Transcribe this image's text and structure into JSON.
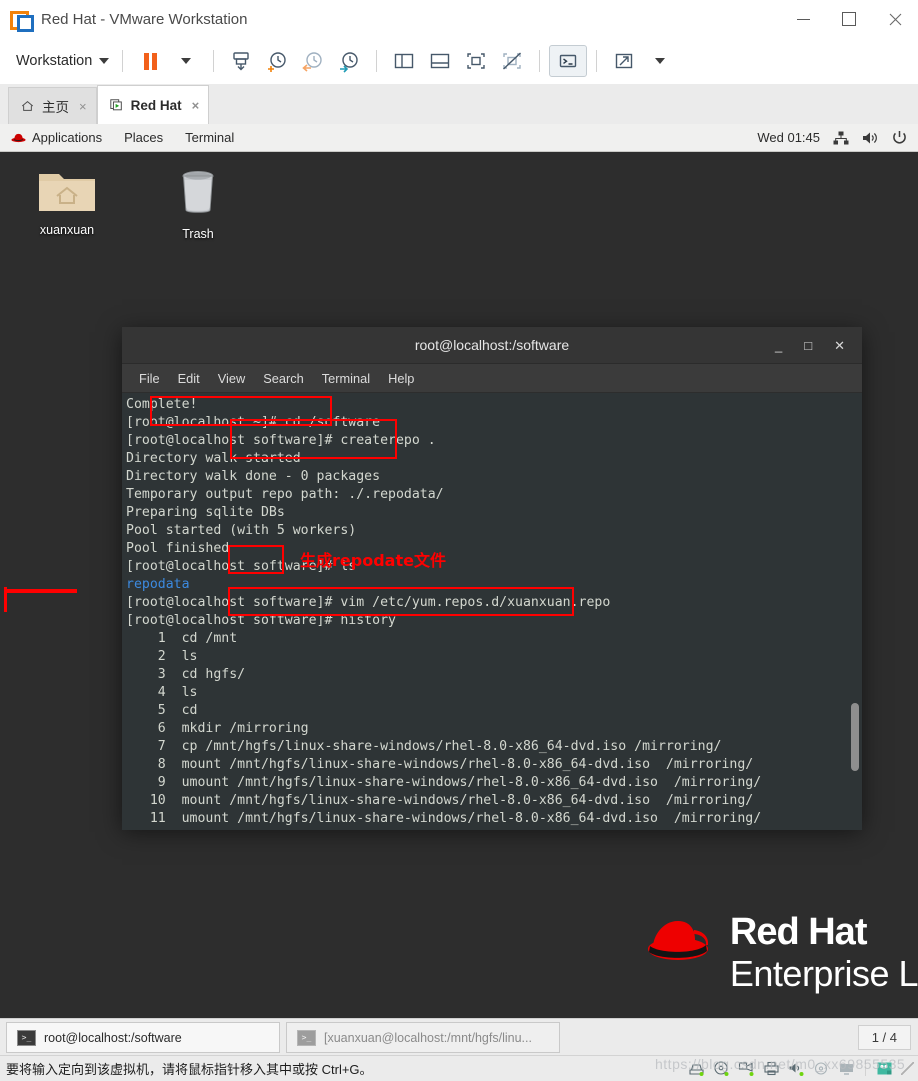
{
  "window": {
    "title": "Red Hat - VMware Workstation",
    "logo_icon": "vmware-logo-icon",
    "minimize_label": "Minimize",
    "maximize_label": "Maximize",
    "close_label": "Close"
  },
  "toolbar": {
    "workstation_menu": "Workstation",
    "items": [
      {
        "name": "pause-button",
        "icon": "pause-icon"
      },
      {
        "name": "pause-dropdown",
        "icon": "chevron-down-icon"
      },
      {
        "name": "send-ctrl-alt-del-button",
        "icon": "snapshot-save-icon"
      },
      {
        "name": "take-snapshot-button",
        "icon": "clock-plus-icon"
      },
      {
        "name": "revert-snapshot-button",
        "icon": "clock-back-icon"
      },
      {
        "name": "snapshot-manager-button",
        "icon": "clock-wrench-icon"
      },
      {
        "name": "show-side-panel-button",
        "icon": "panel-left-icon"
      },
      {
        "name": "show-bottom-panel-button",
        "icon": "panel-bottom-icon"
      },
      {
        "name": "console-view-button",
        "icon": "fit-guest-icon"
      },
      {
        "name": "no-console-view-button",
        "icon": "fit-guest-disabled-icon"
      },
      {
        "name": "terminal-view-button",
        "icon": "terminal-prompt-icon"
      },
      {
        "name": "fullscreen-button",
        "icon": "expand-arrows-icon"
      },
      {
        "name": "fullscreen-dropdown",
        "icon": "chevron-down-icon"
      }
    ]
  },
  "tabs": [
    {
      "label": "主页",
      "icon": "home-icon",
      "active": false,
      "close": "×"
    },
    {
      "label": "Red Hat",
      "icon": "vm-play-icon",
      "active": true,
      "close": "×"
    }
  ],
  "gnome_panel": {
    "logo_icon": "red-hat-fedora-icon",
    "menus": [
      "Applications",
      "Places",
      "Terminal"
    ],
    "clock": "Wed 01:45",
    "tray": [
      {
        "name": "network-icon",
        "icon": "network-icon"
      },
      {
        "name": "volume-icon",
        "icon": "speaker-icon"
      },
      {
        "name": "power-icon",
        "icon": "power-icon"
      }
    ]
  },
  "desktop_icons": [
    {
      "label": "xuanxuan",
      "icon": "home-folder-icon"
    },
    {
      "label": "Trash",
      "icon": "trash-icon"
    }
  ],
  "terminal": {
    "title": "root@localhost:/software",
    "minimize": "_",
    "maximize": "□",
    "close": "✕",
    "menus": [
      "File",
      "Edit",
      "View",
      "Search",
      "Terminal",
      "Help"
    ],
    "lines": [
      {
        "text": "Complete!"
      },
      {
        "text": "[root@localhost ~]# cd /software"
      },
      {
        "text": "[root@localhost software]# createrepo ."
      },
      {
        "text": "Directory walk started"
      },
      {
        "text": "Directory walk done - 0 packages"
      },
      {
        "text": "Temporary output repo path: ./.repodata/"
      },
      {
        "text": "Preparing sqlite DBs"
      },
      {
        "text": "Pool started (with 5 workers)"
      },
      {
        "text": "Pool finished"
      },
      {
        "text": "[root@localhost software]# ls"
      },
      {
        "text": "repodata",
        "color": "blue"
      },
      {
        "text": "[root@localhost software]# vim /etc/yum.repos.d/xuanxuan.repo"
      },
      {
        "text": "[root@localhost software]# history"
      },
      {
        "text": "    1  cd /mnt"
      },
      {
        "text": "    2  ls"
      },
      {
        "text": "    3  cd hgfs/"
      },
      {
        "text": "    4  ls"
      },
      {
        "text": "    5  cd"
      },
      {
        "text": "    6  mkdir /mirroring"
      },
      {
        "text": "    7  cp /mnt/hgfs/linux-share-windows/rhel-8.0-x86_64-dvd.iso /mirroring/"
      },
      {
        "text": "    8  mount /mnt/hgfs/linux-share-windows/rhel-8.0-x86_64-dvd.iso  /mirroring/"
      },
      {
        "text": "    9  umount /mnt/hgfs/linux-share-windows/rhel-8.0-x86_64-dvd.iso  /mirroring/"
      },
      {
        "text": "   10  mount /mnt/hgfs/linux-share-windows/rhel-8.0-x86_64-dvd.iso  /mirroring/"
      },
      {
        "text": "   11  umount /mnt/hgfs/linux-share-windows/rhel-8.0-x86_64-dvd.iso  /mirroring/"
      }
    ]
  },
  "annotations": {
    "color": "#ff0000",
    "note": "生成repodate文件"
  },
  "branding": {
    "line1": "Red Hat",
    "line2": "Enterprise L",
    "hat_icon": "red-hat-fedora-icon",
    "hat_color": "#ee0000"
  },
  "taskbar": {
    "buttons": [
      {
        "label": "root@localhost:/software",
        "icon": "terminal-icon",
        "active": true
      },
      {
        "label": "[xuanxuan@localhost:/mnt/hgfs/linu...",
        "icon": "terminal-icon",
        "active": false
      }
    ],
    "page_indicator": "1 / 4"
  },
  "statusbar": {
    "message": "要将输入定向到该虚拟机，请将鼠标指针移入其中或按 Ctrl+G。",
    "watermark": "https://blog.csdn.net/m0_xx69855535",
    "icons": [
      {
        "name": "hard-disk-icon"
      },
      {
        "name": "cd-dvd-icon"
      },
      {
        "name": "network-adapter-icon"
      },
      {
        "name": "printer-icon"
      },
      {
        "name": "sound-card-icon"
      },
      {
        "name": "usb-icon"
      },
      {
        "name": "display-icon"
      },
      {
        "name": "shared-folders-icon"
      }
    ]
  }
}
